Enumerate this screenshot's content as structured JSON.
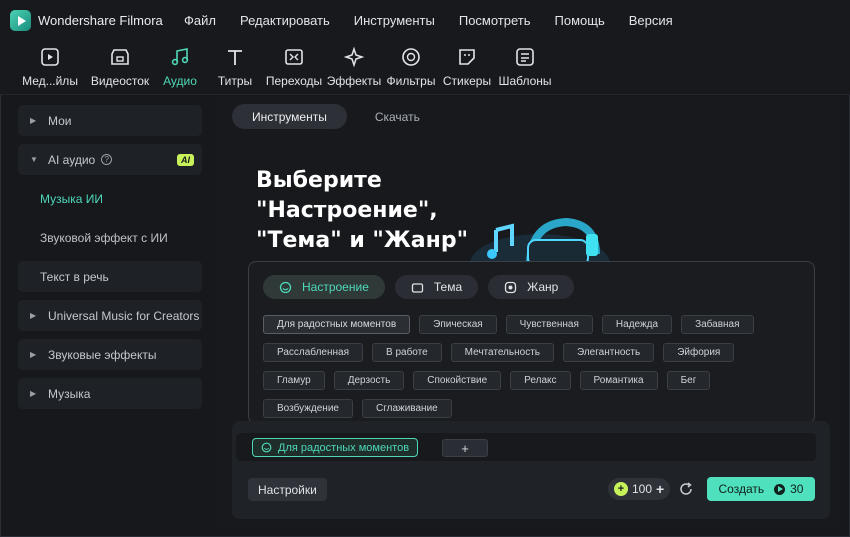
{
  "app": {
    "title": "Wondershare Filmora"
  },
  "menu": [
    "Файл",
    "Редактировать",
    "Инструменты",
    "Посмотреть",
    "Помощь",
    "Версия"
  ],
  "toolbar": [
    {
      "label": "Мед...йлы",
      "icon": "media-icon"
    },
    {
      "label": "Видеосток",
      "icon": "stock-video-icon"
    },
    {
      "label": "Аудио",
      "icon": "audio-icon",
      "active": true
    },
    {
      "label": "Титры",
      "icon": "titles-icon"
    },
    {
      "label": "Переходы",
      "icon": "transitions-icon"
    },
    {
      "label": "Эффекты",
      "icon": "effects-icon"
    },
    {
      "label": "Фильтры",
      "icon": "filters-icon"
    },
    {
      "label": "Стикеры",
      "icon": "stickers-icon"
    },
    {
      "label": "Шаблоны",
      "icon": "templates-icon"
    }
  ],
  "sidebar": {
    "mine": "Мои",
    "ai_audio": "AI аудио",
    "ai_badge": "AI",
    "ai_music": "Музыка ИИ",
    "ai_sfx": "Звуковой эффект с ИИ",
    "tts": "Текст в речь",
    "universal": "Universal Music for Creators",
    "sound_effects": "Звуковые эффекты",
    "music": "Музыка"
  },
  "tabs": [
    "Инструменты",
    "Скачать"
  ],
  "headline": [
    "Выберите",
    "\"Настроение\",",
    "\"Тема\" и \"Жанр\""
  ],
  "categories": [
    "Настроение",
    "Тема",
    "Жанр"
  ],
  "chip_rows": [
    [
      "Для радостных моментов",
      "Эпическая",
      "Чувственная",
      "Надежда",
      "Забавная"
    ],
    [
      "Расслабленная",
      "В работе",
      "Мечтательность",
      "Элегантность",
      "Эйфория"
    ],
    [
      "Гламур",
      "Дерзость",
      "Спокойствие",
      "Релакс",
      "Романтика",
      "Бег"
    ],
    [
      "Возбуждение",
      "Сглаживание"
    ]
  ],
  "selected_tag": "Для радостных моментов",
  "plus_label": "+",
  "settings_label": "Настройки",
  "credits": "100",
  "create_label": "Создать",
  "create_cost": "30",
  "colors": {
    "accent": "#4fd8b8",
    "ai_badge": "#c7f25a",
    "create_button": "#4fe0bd"
  }
}
